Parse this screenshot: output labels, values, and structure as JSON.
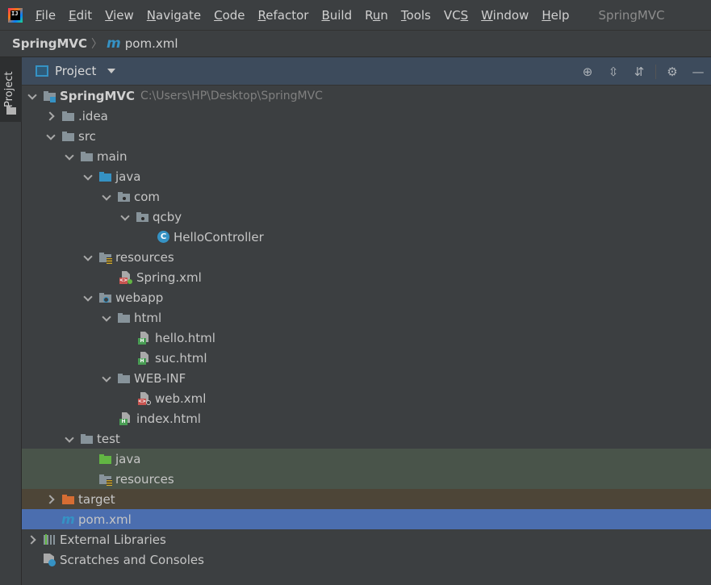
{
  "menubar": {
    "items": [
      "File",
      "Edit",
      "View",
      "Navigate",
      "Code",
      "Refactor",
      "Build",
      "Run",
      "Tools",
      "VCS",
      "Window",
      "Help"
    ],
    "mnemonics": [
      "F",
      "E",
      "V",
      "N",
      "C",
      "R",
      "B",
      "u",
      "T",
      "S",
      "W",
      "H"
    ],
    "window_title": "SpringMVC"
  },
  "breadcrumb": {
    "project": "SpringMVC",
    "file": "pom.xml"
  },
  "tool_strip": {
    "project_tab": "Project"
  },
  "panel": {
    "title": "Project",
    "icons": [
      "locate-icon",
      "expand-all-icon",
      "collapse-all-icon",
      "gear-icon",
      "minimize-icon"
    ]
  },
  "tree": {
    "root": {
      "label": "SpringMVC",
      "path": "C:\\Users\\HP\\Desktop\\SpringMVC"
    },
    "idea": ".idea",
    "src": "src",
    "main": "main",
    "main_java": "java",
    "com": "com",
    "qcby": "qcby",
    "hello_controller": "HelloController",
    "main_resources": "resources",
    "spring_xml": "Spring.xml",
    "webapp": "webapp",
    "html_folder": "html",
    "hello_html": "hello.html",
    "suc_html": "suc.html",
    "web_inf": "WEB-INF",
    "web_xml": "web.xml",
    "index_html": "index.html",
    "test": "test",
    "test_java": "java",
    "test_resources": "resources",
    "target": "target",
    "pom_xml": "pom.xml",
    "external_libraries": "External Libraries",
    "scratches": "Scratches and Consoles"
  },
  "colors": {
    "selection": "#4b6eaf",
    "test_highlight": "#49544a",
    "excluded_highlight": "#4d4537",
    "header_bg": "#3d4b5c"
  }
}
